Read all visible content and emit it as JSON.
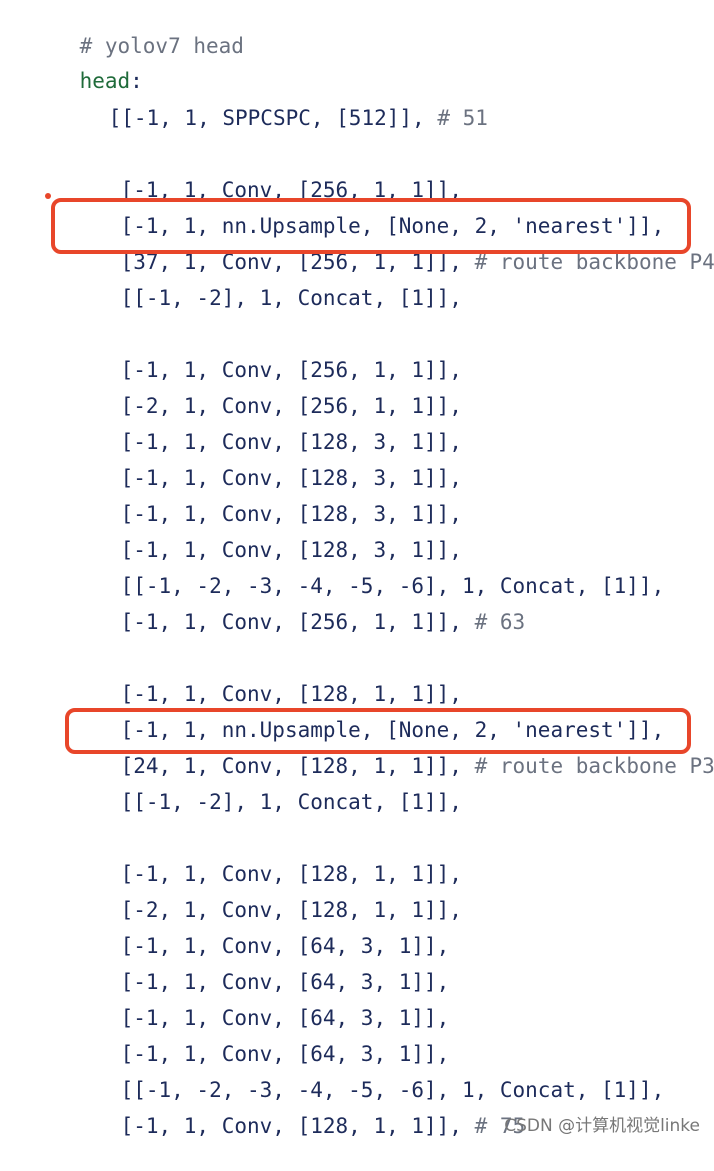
{
  "code": {
    "header_comment": "# yolov7 head",
    "head_key": "head",
    "head_colon": ":",
    "sppcspc_line": "[[-1, 1, SPPCSPC, [512]],",
    "sppcspc_comment": "# 51",
    "l1": "[-1, 1, Conv, [256, 1, 1]],",
    "l2": "[-1, 1, nn.Upsample, [None, 2, 'nearest']],",
    "l3": "[37, 1, Conv, [256, 1, 1]],",
    "l3_comment": "# route backbone P4",
    "l4": "[[-1, -2], 1, Concat, [1]],",
    "l5": "[-1, 1, Conv, [256, 1, 1]],",
    "l6": "[-2, 1, Conv, [256, 1, 1]],",
    "l7": "[-1, 1, Conv, [128, 3, 1]],",
    "l8": "[-1, 1, Conv, [128, 3, 1]],",
    "l9": "[-1, 1, Conv, [128, 3, 1]],",
    "l10": "[-1, 1, Conv, [128, 3, 1]],",
    "l11": "[[-1, -2, -3, -4, -5, -6], 1, Concat, [1]],",
    "l12": "[-1, 1, Conv, [256, 1, 1]],",
    "l12_comment": "# 63",
    "l13": "[-1, 1, Conv, [128, 1, 1]],",
    "l14": "[-1, 1, nn.Upsample, [None, 2, 'nearest']],",
    "l15": "[24, 1, Conv, [128, 1, 1]],",
    "l15_comment": "# route backbone P3",
    "l16": "[[-1, -2], 1, Concat, [1]],",
    "l17": "[-1, 1, Conv, [128, 1, 1]],",
    "l18": "[-2, 1, Conv, [128, 1, 1]],",
    "l19": "[-1, 1, Conv, [64, 3, 1]],",
    "l20": "[-1, 1, Conv, [64, 3, 1]],",
    "l21": "[-1, 1, Conv, [64, 3, 1]],",
    "l22": "[-1, 1, Conv, [64, 3, 1]],",
    "l23": "[[-1, -2, -3, -4, -5, -6], 1, Concat, [1]],",
    "l24": "[-1, 1, Conv, [128, 1, 1]],",
    "l24_comment": "# 75"
  },
  "watermark": "CSDN @计算机视觉linke",
  "colors": {
    "highlight": "#e8462a",
    "code_text": "#1d2b5a",
    "comment": "#6b7280",
    "key": "#1f6b3a"
  }
}
